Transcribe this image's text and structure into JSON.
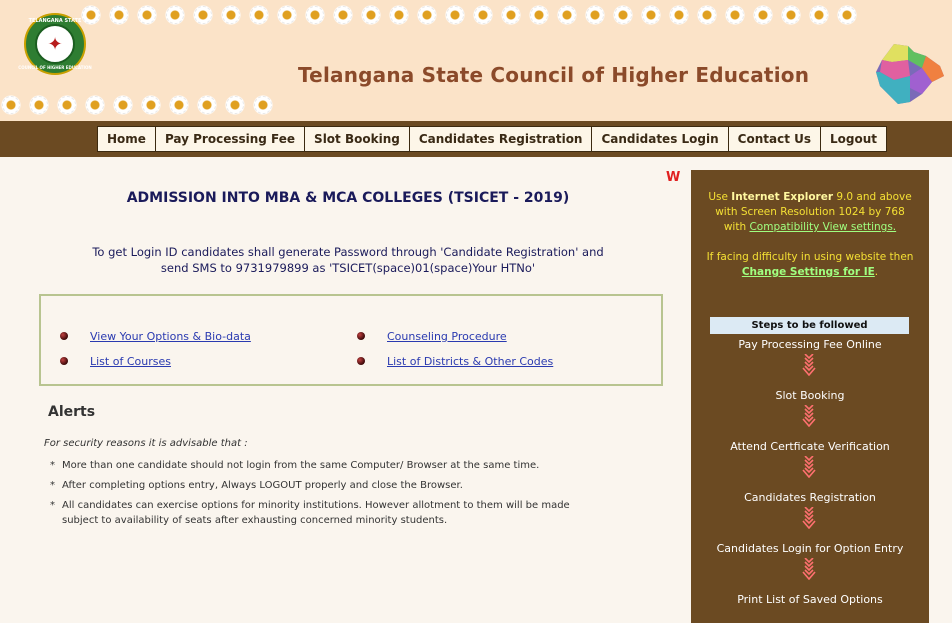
{
  "header": {
    "title": "Telangana State Council of Higher Education",
    "logo_text_top": "TELANGANA STATE",
    "logo_text_bottom": "COUNCIL OF HIGHER EDUCATION"
  },
  "nav": {
    "items": [
      "Home",
      "Pay Processing Fee",
      "Slot Booking",
      "Candidates Registration",
      "Candidates Login",
      "Contact Us",
      "Logout"
    ]
  },
  "main": {
    "title": "ADMISSION INTO MBA & MCA COLLEGES (TSICET - 2019)",
    "login_info_line1": "To get Login ID candidates shall generate Password through 'Candidate Registration' and",
    "login_info_line2": "send SMS to 9731979899 as 'TSICET(space)01(space)Your HTNo'",
    "marquee_fragment": "W",
    "links": {
      "view_options": "View Your Options & Bio-data",
      "list_courses": "List of Courses",
      "counseling": "Counseling Procedure",
      "districts": "List of Districts & Other Codes"
    }
  },
  "alerts": {
    "title": "Alerts",
    "intro": "For security reasons it is advisable that :",
    "items": [
      "More than one candidate should not login from the same Computer/ Browser at the same time.",
      "After completing options entry, Always LOGOUT properly and close the Browser.",
      "All candidates can exercise options for minority institutions. However allotment to them will be made subject to availability of seats after exhausting concerned minority students."
    ]
  },
  "sidebar": {
    "use_text": "Use",
    "browser": "Internet Explorer",
    "browser_version": "9.0 and above",
    "resolution_text": "with Screen Resolution 1024 by 768",
    "with_text": "with",
    "compat_link": "Compatibility View settings.",
    "difficulty_text": "If facing difficulty in using website then",
    "change_link": "Change Settings for IE",
    "period": ".",
    "steps_header": "Steps to be followed",
    "steps": [
      "Pay Processing Fee Online",
      "Slot Booking",
      "Attend Certficate Verification",
      "Candidates Registration",
      "Candidates Login for Option Entry",
      "Print List of Saved Options"
    ]
  },
  "colors": {
    "header_bg": "#fbe3c8",
    "nav_bar": "#6b4a22",
    "title_brown": "#8b4a2a",
    "heading_navy": "#1a1a5a",
    "sidebar_yellow": "#f4e034",
    "sidebar_link_green": "#a0ff80"
  }
}
